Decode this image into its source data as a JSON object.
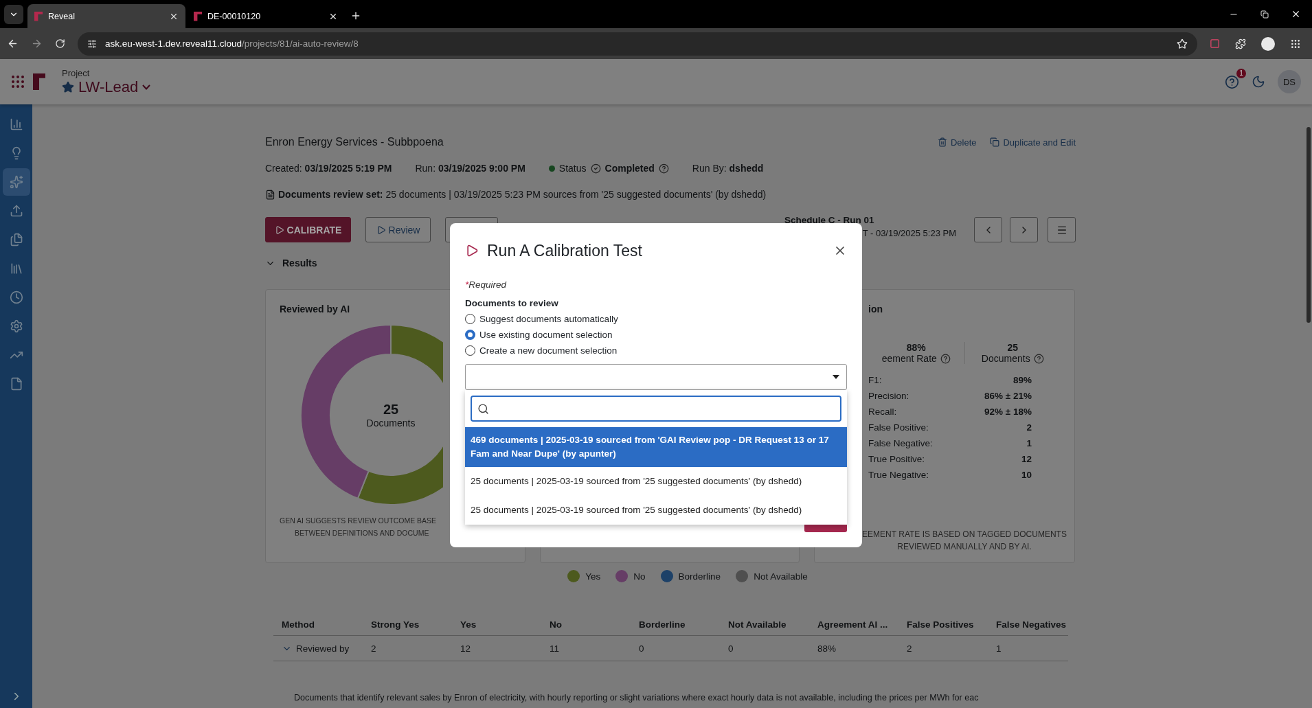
{
  "browser": {
    "tabs": [
      {
        "title": "Reveal",
        "selected": true
      },
      {
        "title": "DE-00010120",
        "selected": false
      }
    ],
    "url": {
      "host": "ask.eu-west-1.dev.reveal11.cloud",
      "path": "/projects/81/ai-auto-review/8"
    }
  },
  "header": {
    "label": "Project",
    "project": "LW-Lead",
    "notifications": "1",
    "avatar": "DS"
  },
  "sidebar": {
    "items": [
      {
        "selected": false
      },
      {
        "selected": false
      },
      {
        "selected": true
      },
      {
        "selected": false
      },
      {
        "selected": false
      },
      {
        "selected": false
      },
      {
        "selected": false
      },
      {
        "selected": false
      },
      {
        "selected": false
      },
      {
        "selected": false
      }
    ]
  },
  "review": {
    "title": "Enron Energy Services - Subbpoena",
    "actions": [
      {
        "kind": "delete",
        "label": "Delete"
      },
      {
        "kind": "duplicate",
        "label": "Duplicate and Edit"
      }
    ],
    "meta": [
      {
        "label": "Created:",
        "value": "03/19/2025 5:19 PM"
      },
      {
        "label": "Run:",
        "value": "03/19/2025 9:00 PM"
      }
    ],
    "status": {
      "label": "Status",
      "value": "Completed"
    },
    "run_by": {
      "label": "Run By:",
      "value": "dshedd"
    },
    "review_set": {
      "label": "Documents review set:",
      "value": "25 documents | 03/19/2025 5:23 PM sources from '25 suggested documents' (by dshedd)"
    },
    "buttons": [
      {
        "kind": "primary",
        "label": "CALIBRATE"
      },
      {
        "kind": "outline",
        "label": "Review"
      },
      {
        "kind": "blank"
      }
    ],
    "schedule": {
      "name": "Schedule C - Run 01",
      "date": "T - 03/19/2025 5:23 PM"
    },
    "results": {
      "label": "Results",
      "expanded": true
    }
  },
  "left_panel": {
    "title": "Reviewed by AI",
    "total": "25",
    "total_label": "Documents",
    "caption": [
      "GEN AI SUGGESTS REVIEW OUTCOME BASE",
      "BETWEEN DEFINITIONS AND DOCUME"
    ]
  },
  "right_panel": {
    "title": "ion",
    "stats": [
      {
        "value": "88%",
        "label": "eement Rate"
      },
      {
        "value": "25",
        "label": "Documents"
      }
    ],
    "metrics": [
      {
        "label": "F1:",
        "value": "89%"
      },
      {
        "label": "Precision:",
        "value": "86% ± 21%"
      },
      {
        "label": "Recall:",
        "value": "92% ± 18%"
      },
      {
        "label": "False Positive:",
        "value": "2"
      },
      {
        "label": "False Negative:",
        "value": "1"
      },
      {
        "label": "True Positive:",
        "value": "12"
      },
      {
        "label": "True Negative:",
        "value": "10"
      }
    ],
    "caption": [
      "EEMENT RATE IS BASED ON TAGGED DOCUMENTS",
      "REVIEWED MANUALLY AND BY AI."
    ]
  },
  "legend": [
    {
      "label": "Yes",
      "color": "#4d5a1e"
    },
    {
      "label": "No",
      "color": "#663d66"
    },
    {
      "label": "Borderline",
      "color": "#1d4168"
    },
    {
      "label": "Not Available",
      "color": "#4f4f4f"
    }
  ],
  "table": {
    "columns": [
      "Method",
      "Strong Yes",
      "Yes",
      "No",
      "Borderline",
      "Not Available",
      "Agreement AI ...",
      "False Positives",
      "False Negatives"
    ],
    "rows": [
      {
        "expanded": true,
        "cells": [
          "Reviewed by",
          "2",
          "12",
          "11",
          "0",
          "0",
          "88%",
          "2",
          "1"
        ]
      }
    ]
  },
  "description": "Documents that identify relevant sales by Enron of electricity, with hourly reporting or slight variations where exact hourly data is not available, including the prices per MWh for eac",
  "modal": {
    "title": "Run A Calibration Test",
    "required_mark": "*",
    "required": "Required",
    "section": "Documents to review",
    "choices": [
      {
        "label": "Suggest documents automatically",
        "selected": false
      },
      {
        "label": "Use existing document selection",
        "selected": true
      },
      {
        "label": "Create a new document selection",
        "selected": false
      }
    ],
    "options": [
      {
        "label": "469 documents | 2025-03-19 sourced from 'GAI Review pop - DR Request 13 or 17 Fam and Near Dupe' (by apunter)",
        "selected": true
      },
      {
        "label": "25 documents | 2025-03-19 sourced from '25 suggested documents' (by dshedd)",
        "selected": false
      },
      {
        "label": "25 documents | 2025-03-19 sourced from '25 suggested documents' (by dshedd)",
        "selected": false
      }
    ]
  }
}
